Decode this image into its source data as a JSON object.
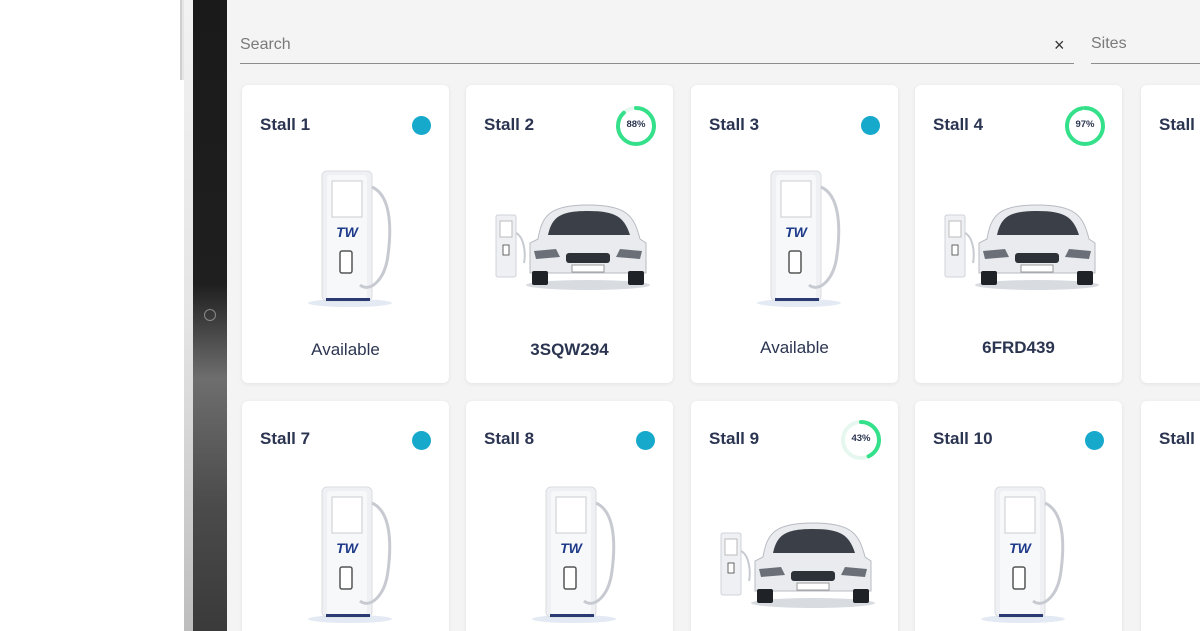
{
  "search": {
    "placeholder": "Search",
    "clear_label": "×"
  },
  "sites": {
    "label": "Sites"
  },
  "stalls": [
    {
      "title": "Stall 1",
      "status": "available",
      "label": "Available"
    },
    {
      "title": "Stall 2",
      "status": "charging",
      "charge_percent": 88,
      "charge_text": "88%",
      "label": "3SQW294"
    },
    {
      "title": "Stall 3",
      "status": "available",
      "label": "Available"
    },
    {
      "title": "Stall 4",
      "status": "charging",
      "charge_percent": 97,
      "charge_text": "97%",
      "label": "6FRD439"
    },
    {
      "title": "Stall",
      "status": "partial"
    },
    {
      "title": "Stall 7",
      "status": "available"
    },
    {
      "title": "Stall 8",
      "status": "available"
    },
    {
      "title": "Stall 9",
      "status": "charging",
      "charge_percent": 43,
      "charge_text": "43%"
    },
    {
      "title": "Stall 10",
      "status": "available"
    },
    {
      "title": "Stall",
      "status": "partial"
    }
  ],
  "colors": {
    "available_dot": "#17a9cc",
    "charge_ring": "#35e08a",
    "title_text": "#2b3551"
  },
  "brand": {
    "logo_text": "TW"
  }
}
